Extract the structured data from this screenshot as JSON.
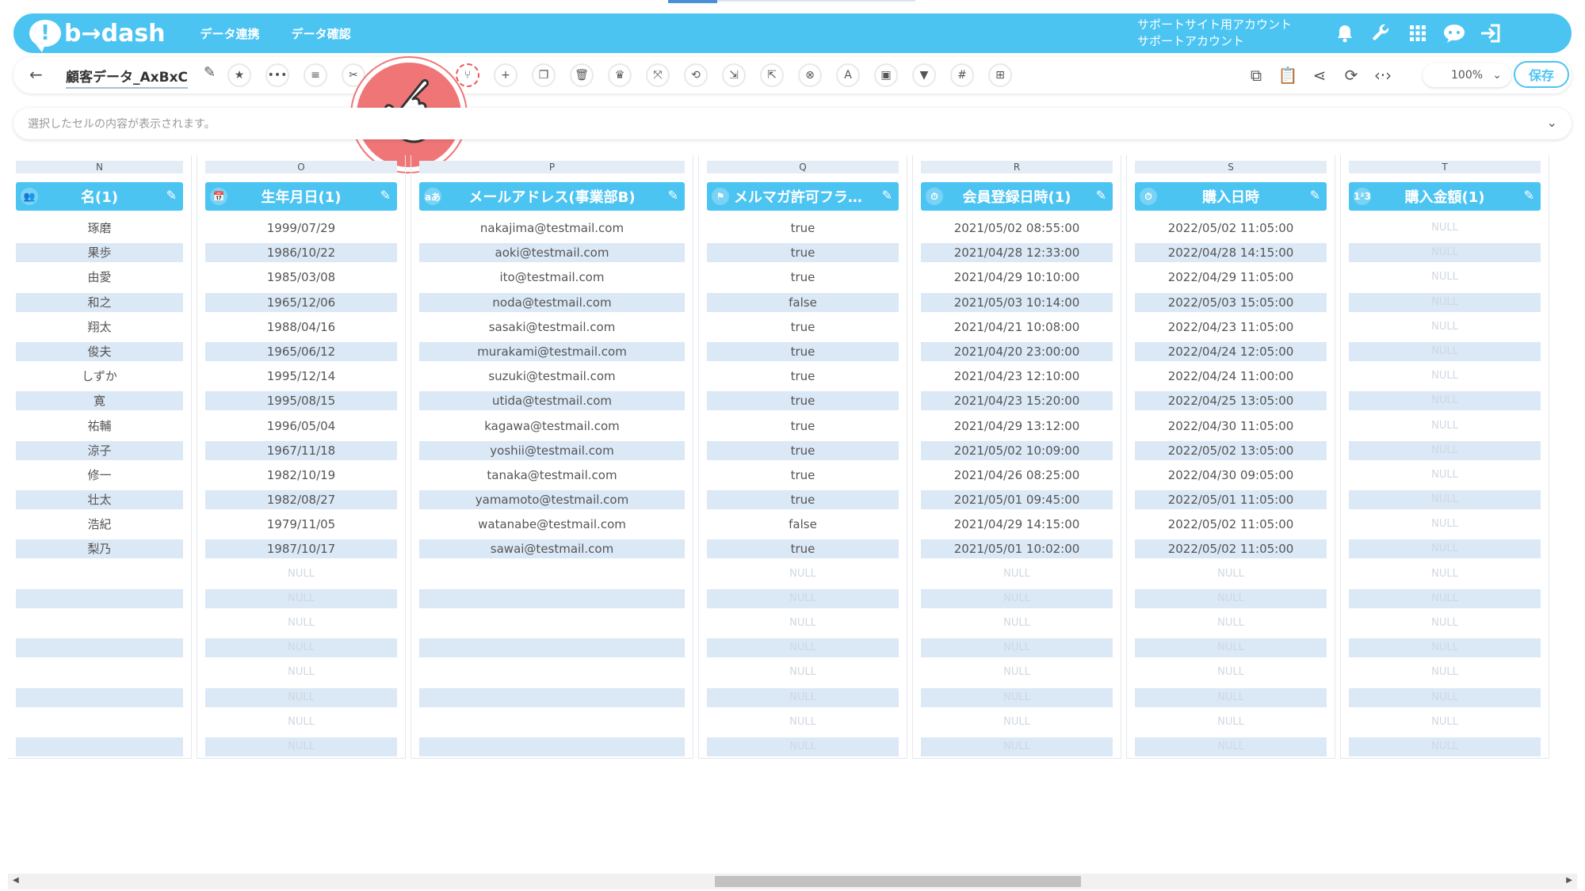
{
  "header": {
    "logo_text": "b→dash",
    "nav": [
      "データ連携",
      "データ確認"
    ],
    "account_line1": "サポートサイト用アカウント",
    "account_line2": "サポートアカウント",
    "icons": [
      "bell-icon",
      "wrench-icon",
      "apps-grid-icon",
      "chat-bot-icon",
      "logout-icon"
    ]
  },
  "toolbar": {
    "dataset_name": "顧客データ_AxBxC",
    "zoom": "100%",
    "save_label": "保存",
    "tools": [
      "star-icon",
      "more-icon",
      "list-icon",
      "scissors-icon",
      "merge-icon",
      "plus-icon",
      "copy-icon",
      "trash-icon",
      "crown-icon",
      "expand-icon",
      "repeat-icon",
      "import-icon",
      "export-icon",
      "cancel-icon",
      "translate-icon",
      "box-icon",
      "filter-icon",
      "hash-icon",
      "table-icon"
    ],
    "right_icons": [
      "flow-icon",
      "clipboard-icon",
      "share-icon",
      "refresh-icon",
      "code-icon"
    ]
  },
  "cell_bar": {
    "placeholder": "選択したセルの内容が表示されます。"
  },
  "null_text": "NULL",
  "columns": [
    {
      "letter": "N",
      "label": "名(1)",
      "icon": "people-icon",
      "values": [
        "琢磨",
        "果歩",
        "由愛",
        "和之",
        "翔太",
        "俊夫",
        "しずか",
        "寛",
        "祐輔",
        "涼子",
        "修一",
        "壮太",
        "浩紀",
        "梨乃"
      ]
    },
    {
      "letter": "O",
      "label": "生年月日(1)",
      "icon": "calendar-icon",
      "values": [
        "1999/07/29",
        "1986/10/22",
        "1985/03/08",
        "1965/12/06",
        "1988/04/16",
        "1965/06/12",
        "1995/12/14",
        "1995/08/15",
        "1996/05/04",
        "1967/11/18",
        "1982/10/19",
        "1982/08/27",
        "1979/11/05",
        "1987/10/17"
      ]
    },
    {
      "letter": "P",
      "label": "メールアドレス(事業部B)",
      "icon": "text-icon",
      "values": [
        "nakajima@testmail.com",
        "aoki@testmail.com",
        "ito@testmail.com",
        "noda@testmail.com",
        "sasaki@testmail.com",
        "murakami@testmail.com",
        "suzuki@testmail.com",
        "utida@testmail.com",
        "kagawa@testmail.com",
        "yoshii@testmail.com",
        "tanaka@testmail.com",
        "yamamoto@testmail.com",
        "watanabe@testmail.com",
        "sawai@testmail.com"
      ]
    },
    {
      "letter": "Q",
      "label": "メルマガ許可フラグ…",
      "icon": "flag-icon",
      "values": [
        "true",
        "true",
        "true",
        "false",
        "true",
        "true",
        "true",
        "true",
        "true",
        "true",
        "true",
        "true",
        "false",
        "true"
      ]
    },
    {
      "letter": "R",
      "label": "会員登録日時(1)",
      "icon": "clock-icon",
      "values": [
        "2021/05/02 08:55:00",
        "2021/04/28 12:33:00",
        "2021/04/29 10:10:00",
        "2021/05/03 10:14:00",
        "2021/04/21 10:08:00",
        "2021/04/20 23:00:00",
        "2021/04/23 12:10:00",
        "2021/04/23 15:20:00",
        "2021/04/29 13:12:00",
        "2021/05/02 10:09:00",
        "2021/04/26 08:25:00",
        "2021/05/01 09:45:00",
        "2021/04/29 14:15:00",
        "2021/05/01 10:02:00"
      ]
    },
    {
      "letter": "S",
      "label": "購入日時",
      "icon": "clock-icon",
      "values": [
        "2022/05/02 11:05:00",
        "2022/04/28 14:15:00",
        "2022/04/29 11:05:00",
        "2022/05/03 15:05:00",
        "2022/04/23 11:05:00",
        "2022/04/24 12:05:00",
        "2022/04/24 11:00:00",
        "2022/04/25 13:05:00",
        "2022/04/30 11:05:00",
        "2022/05/02 13:05:00",
        "2022/04/30 09:05:00",
        "2022/05/01 11:05:00",
        "2022/05/02 11:05:00",
        "2022/05/02 11:05:00"
      ]
    },
    {
      "letter": "T",
      "label": "購入金額(1)",
      "icon": "number-icon",
      "values": []
    }
  ]
}
